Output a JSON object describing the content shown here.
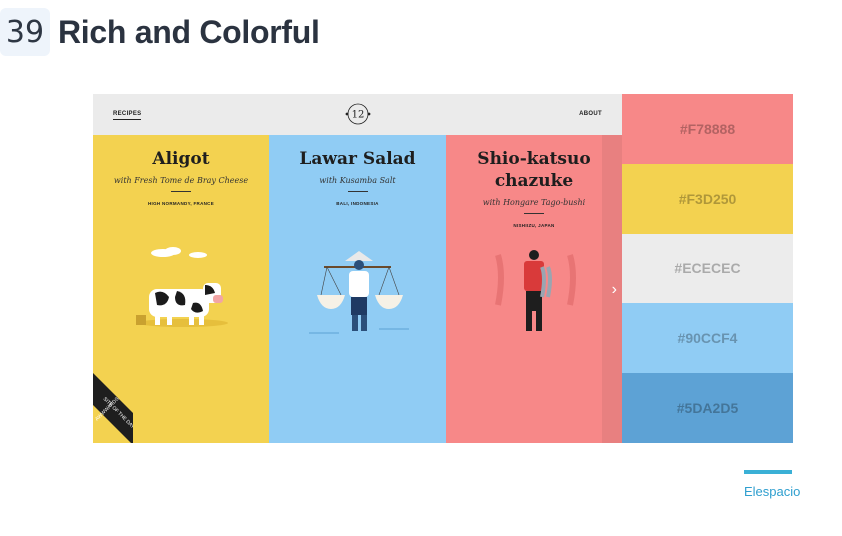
{
  "header": {
    "number": "39",
    "title": "Rich and Colorful"
  },
  "website": {
    "nav_left": "RECIPES",
    "nav_right": "ABOUT",
    "logo": "12",
    "ribbon_top": "SITE OF THE DAY",
    "ribbon_bottom": "AWWWARDS",
    "dishes": [
      {
        "title": "Aligot",
        "subtitle": "with Fresh Tome de Bray Cheese",
        "location": "HIGH NORMANDY, FRANCE",
        "illustration": "cow-illustration"
      },
      {
        "title": "Lawar Salad",
        "subtitle": "with Kusamba Salt",
        "location": "BALI, INDONESIA",
        "illustration": "salt-carrier-illustration"
      },
      {
        "title_line1": "Shio-katsuo",
        "title_line2": "chazuke",
        "subtitle": "with Hongare Tago-bushi",
        "location": "NISHIIZU, JAPAN",
        "illustration": "fisherman-illustration"
      }
    ],
    "colors": {
      "yellow": "#f3d250",
      "blue": "#90ccf4",
      "pink": "#f78888"
    }
  },
  "palette": [
    {
      "hex": "#F78888"
    },
    {
      "hex": "#F3D250"
    },
    {
      "hex": "#ECECEC"
    },
    {
      "hex": "#90CCF4"
    },
    {
      "hex": "#5DA2D5"
    }
  ],
  "credit": {
    "label": "Elespacio",
    "accent": "#3ab0d6"
  }
}
